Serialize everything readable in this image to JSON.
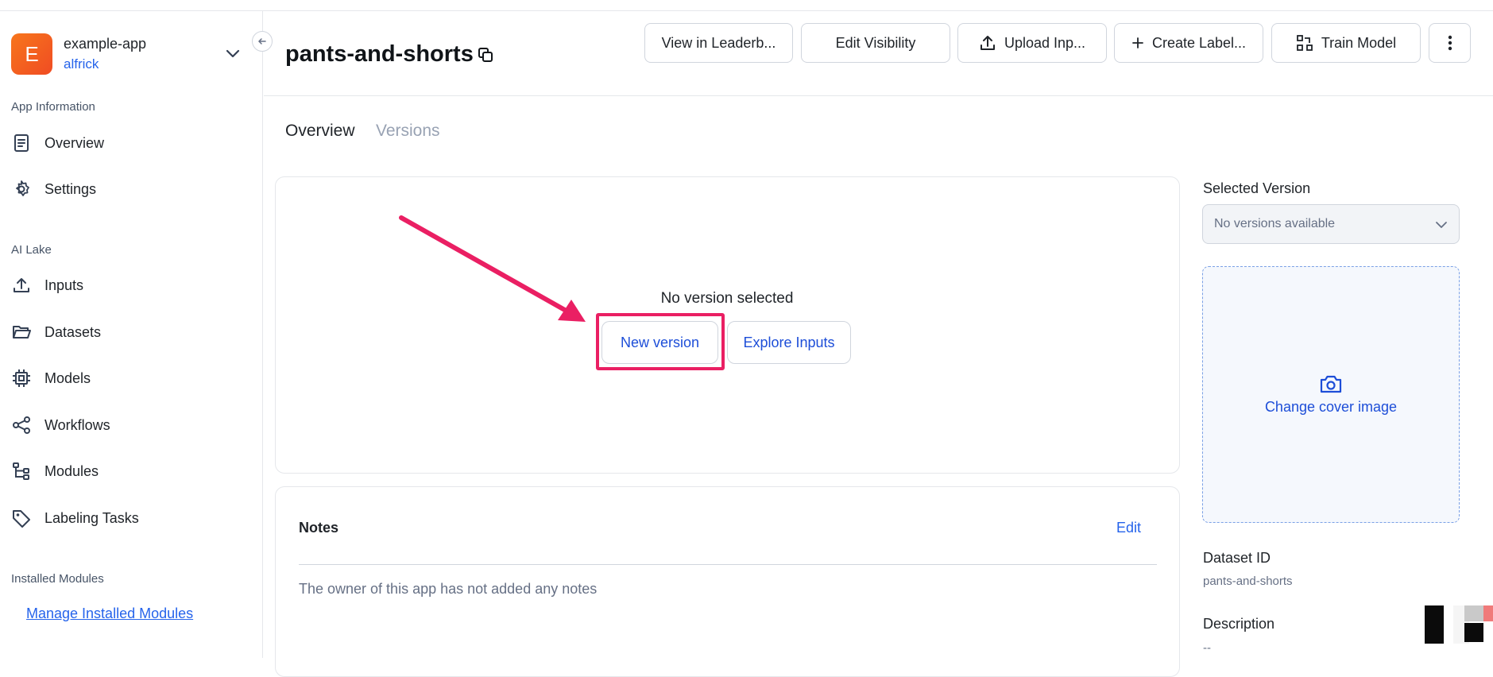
{
  "app": {
    "avatar_letter": "E",
    "name": "example-app",
    "owner": "alfrick"
  },
  "sidebar": {
    "sections": {
      "app_information": "App Information",
      "ai_lake": "AI Lake",
      "installed_modules": "Installed Modules"
    },
    "items": [
      {
        "label": "Overview",
        "icon": "document-icon"
      },
      {
        "label": "Settings",
        "icon": "gear-icon"
      },
      {
        "label": "Inputs",
        "icon": "upload-icon"
      },
      {
        "label": "Datasets",
        "icon": "folder-icon"
      },
      {
        "label": "Models",
        "icon": "chip-icon"
      },
      {
        "label": "Workflows",
        "icon": "share-nodes-icon"
      },
      {
        "label": "Modules",
        "icon": "tree-branch-icon"
      },
      {
        "label": "Labeling Tasks",
        "icon": "tag-icon"
      }
    ],
    "manage_link": "Manage Installed Modules"
  },
  "header": {
    "title": "pants-and-shorts",
    "buttons": {
      "leaderboard": "View in Leaderb...",
      "visibility": "Edit Visibility",
      "upload": "Upload Inp...",
      "create_label": "Create Label...",
      "train": "Train Model"
    }
  },
  "tabs": {
    "overview": "Overview",
    "versions": "Versions"
  },
  "version_card": {
    "status": "No version selected",
    "new_version": "New version",
    "explore_inputs": "Explore Inputs"
  },
  "notes": {
    "title": "Notes",
    "edit": "Edit",
    "text": "The owner of this app has not added any notes"
  },
  "right_panel": {
    "selected_version_label": "Selected Version",
    "version_select_value": "No versions available",
    "change_cover": "Change cover image",
    "dataset_id_label": "Dataset ID",
    "dataset_id_value": "pants-and-shorts",
    "description_label": "Description",
    "description_value": "--"
  },
  "colors": {
    "accent": "#2563eb",
    "highlight": "#ea1f63",
    "avatar": "#f46324"
  }
}
